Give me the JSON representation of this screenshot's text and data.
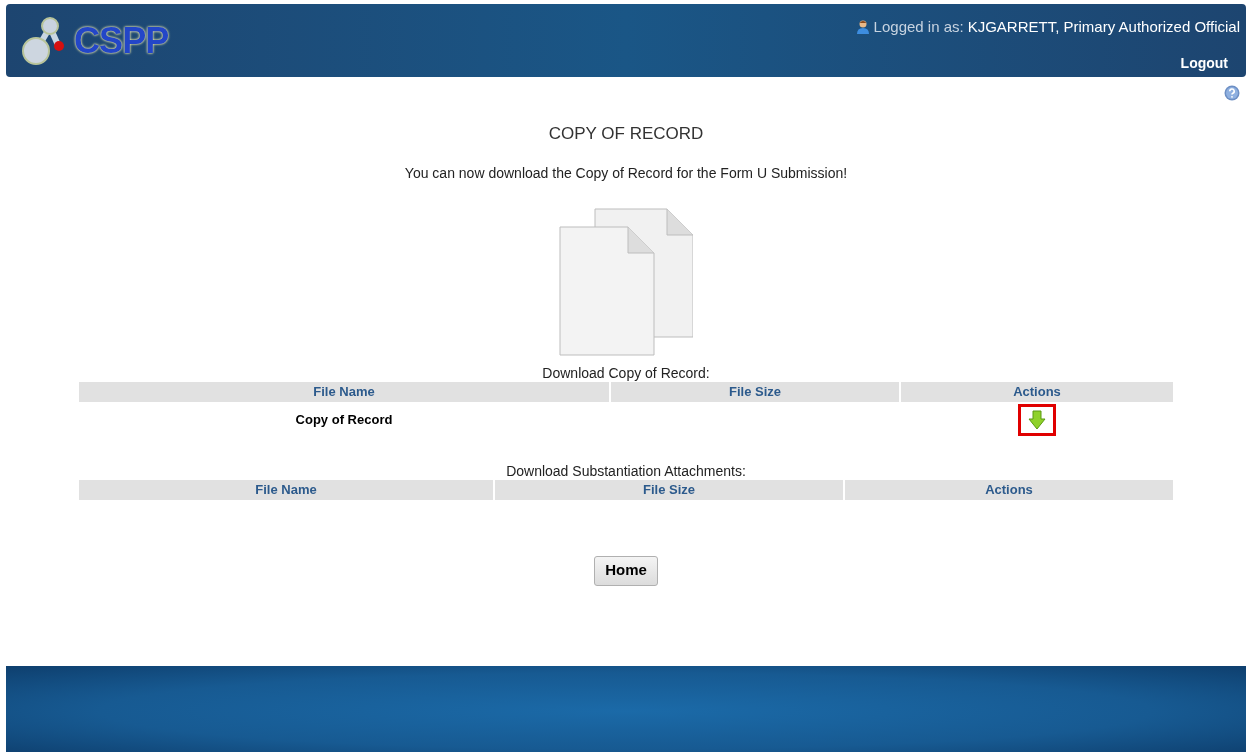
{
  "header": {
    "logo_text": "CSPP",
    "user_label": "Logged in as:",
    "user_name": "KJGARRETT, Primary Authorized Official",
    "logout": "Logout"
  },
  "page": {
    "title": "COPY OF RECORD",
    "message": "You can now download the Copy of Record for the Form U Submission!"
  },
  "tables": [
    {
      "caption": "Download Copy of Record:",
      "columns": [
        "File Name",
        "File Size",
        "Actions"
      ],
      "rows": [
        {
          "file_name": "Copy of Record",
          "action": {
            "kind": "download",
            "highlighted": true
          }
        }
      ]
    },
    {
      "caption": "Download Substantiation Attachments:",
      "columns": [
        "File Name",
        "File Size",
        "Actions"
      ]
    }
  ],
  "home_button": "Home"
}
